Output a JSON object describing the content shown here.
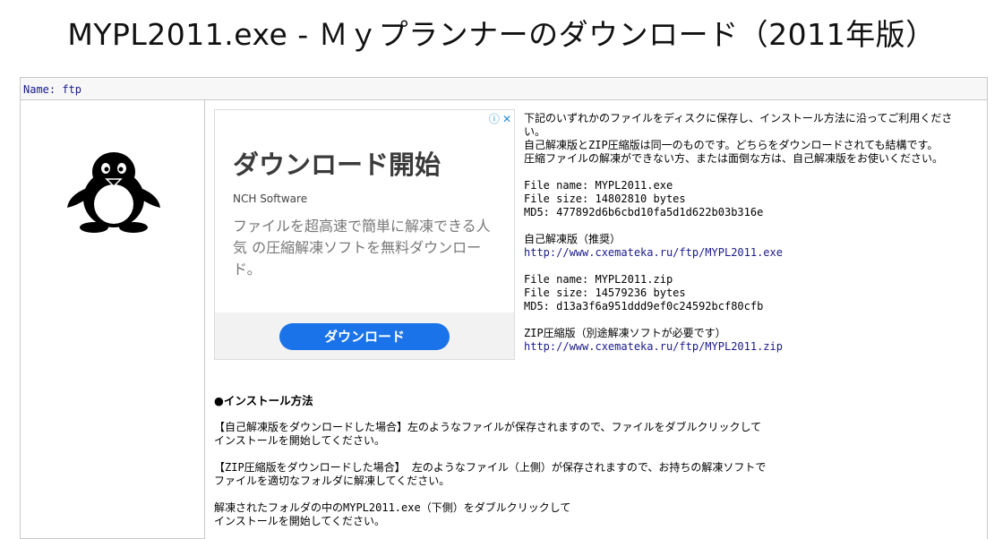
{
  "page": {
    "title": "MYPL2011.exe - Ｍｙプランナーのダウンロード（2011年版）"
  },
  "namebar": {
    "text": "Name: ftp"
  },
  "ad": {
    "heading": "ダウンロード開始",
    "brand": "NCH Software",
    "description": "ファイルを超高速で簡単に解凍できる人気 の圧縮解凍ソフトを無料ダウンロード。",
    "button_label": "ダウンロード",
    "choices_icon": "info-icon",
    "close_icon": "close-icon",
    "accent_color": "#1a73e8"
  },
  "info": {
    "intro1": "下記のいずれかのファイルをディスクに保存し、インストール方法に沿ってご利用ください。",
    "intro2": "自己解凍版とZIP圧縮版は同一のものです。どちらをダウンロードされても結構です。",
    "intro3": "圧縮ファイルの解凍ができない方、または面倒な方は、自己解凍版をお使いください。",
    "exe": {
      "file_name": "File name: MYPL2011.exe",
      "file_size": "File size: 14802810 bytes",
      "md5": "MD5: 477892d6b6cbd10fa5d1d622b03b316e",
      "label": "自己解凍版（推奨）",
      "link": "http://www.cxematekа.ru/ftp/MYPL2011.exe"
    },
    "zip": {
      "file_name": "File name: MYPL2011.zip",
      "file_size": "File size: 14579236 bytes",
      "md5": "MD5: d13a3f6a951ddd9ef0c24592bcf80cfb",
      "label": "ZIP圧縮版（別途解凍ソフトが必要です）",
      "link": "http://www.cxematekа.ru/ftp/MYPL2011.zip"
    }
  },
  "install": {
    "heading": "●インストール方法",
    "exe_line1": "【自己解凍版をダウンロードした場合】左のようなファイルが保存されますので、ファイルをダブルクリックして",
    "exe_line2": "インストールを開始してください。",
    "zip_line1": "【ZIP圧縮版をダウンロードした場合】 左のようなファイル（上側）が保存されますので、お持ちの解凍ソフトで",
    "zip_line2": "ファイルを適切なフォルダに解凍してください。",
    "run_line1": "解凍されたフォルダの中のMYPL2011.exe（下側）をダブルクリックして",
    "run_line2": "インストールを開始してください。"
  }
}
